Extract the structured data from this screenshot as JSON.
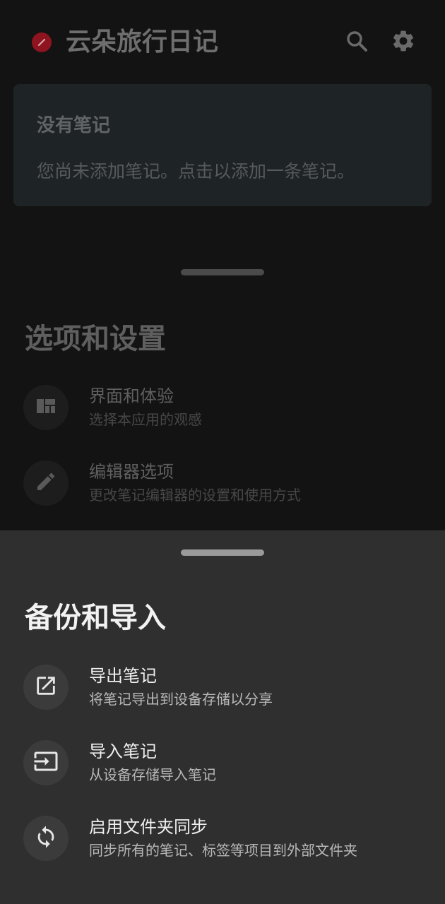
{
  "app_bar": {
    "title": "云朵旅行日记",
    "logo_icon": "pencil-badge-icon",
    "search_icon": "search-icon",
    "settings_icon": "gear-icon"
  },
  "empty_state": {
    "title": "没有笔记",
    "description": "您尚未添加笔记。点击以添加一条笔记。"
  },
  "options_sheet": {
    "title": "选项和设置",
    "items": [
      {
        "icon": "dashboard-icon",
        "title": "界面和体验",
        "subtitle": "选择本应用的观感"
      },
      {
        "icon": "pencil-icon",
        "title": "编辑器选项",
        "subtitle": "更改笔记编辑器的设置和使用方式"
      }
    ]
  },
  "backup_sheet": {
    "title": "备份和导入",
    "items": [
      {
        "icon": "export-icon",
        "title": "导出笔记",
        "subtitle": "将笔记导出到设备存储以分享"
      },
      {
        "icon": "import-icon",
        "title": "导入笔记",
        "subtitle": "从设备存储导入笔记"
      },
      {
        "icon": "sync-icon",
        "title": "启用文件夹同步",
        "subtitle": "同步所有的笔记、标签等项目到外部文件夹"
      }
    ]
  },
  "colors": {
    "background": "#131313",
    "sheet": "#2f2f2f",
    "card": "#1e2326",
    "logo": "#8e1420"
  }
}
